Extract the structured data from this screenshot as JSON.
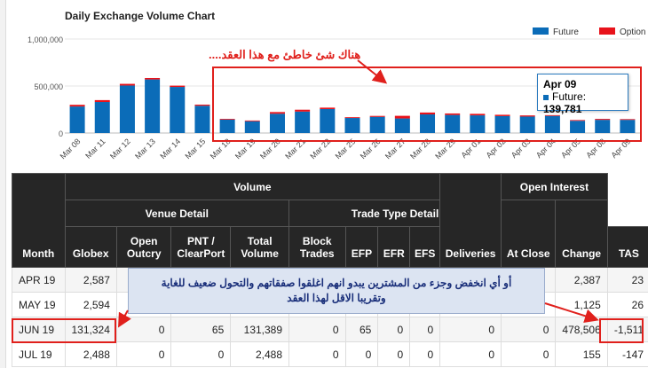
{
  "chart_data": {
    "type": "bar",
    "title": "Daily Exchange Volume Chart",
    "categories": [
      "Mar 08",
      "Mar 11",
      "Mar 12",
      "Mar 13",
      "Mar 14",
      "Mar 15",
      "Mar 18",
      "Mar 19",
      "Mar 20",
      "Mar 21",
      "Mar 22",
      "Mar 25",
      "Mar 26",
      "Mar 27",
      "Mar 28",
      "Mar 29",
      "Apr 01",
      "Apr 02",
      "Apr 03",
      "Apr 04",
      "Apr 05",
      "Apr 08",
      "Apr 09"
    ],
    "series": [
      {
        "name": "Future",
        "color": "#0b6cb8",
        "values": [
          282000,
          330000,
          505000,
          570000,
          490000,
          290000,
          143000,
          125000,
          205000,
          228000,
          255000,
          160000,
          172000,
          155000,
          198000,
          192000,
          188000,
          180000,
          175000,
          182000,
          130000,
          140000,
          139781
        ]
      },
      {
        "name": "Option",
        "color": "#e8131b",
        "values": [
          18000,
          20000,
          18000,
          15000,
          14000,
          12000,
          8000,
          8000,
          18000,
          20000,
          15000,
          8000,
          10000,
          28000,
          20000,
          16000,
          16000,
          14000,
          12000,
          8000,
          8000,
          10000,
          8000
        ]
      }
    ],
    "ylim": [
      0,
      1000000
    ],
    "yticks": [
      "0",
      "500,000",
      "1,000,000"
    ],
    "legend_position": "top-right",
    "tooltip": {
      "date": "Apr 09",
      "series": "Future",
      "value": "139,781"
    }
  },
  "annotations": {
    "chart_note": "هناك شئ خاطئ مع هذا العقد....",
    "table_note_line1": "أو أي انخفض وجزء من المشترين يبدو انهم اغلقوا صفقاتهم والتحول ضعيف للغاية",
    "table_note_line2": "وتقريبا الاقل لهذا العقد"
  },
  "table": {
    "group_volume": "Volume",
    "group_venue": "Venue Detail",
    "group_trade": "Trade Type Detail",
    "group_oi": "Open Interest",
    "headers": {
      "month": "Month",
      "globex": "Globex",
      "open_outcry_1": "Open",
      "open_outcry_2": "Outcry",
      "pnt_1": "PNT /",
      "pnt_2": "ClearPort",
      "total_1": "Total",
      "total_2": "Volume",
      "block_1": "Block",
      "block_2": "Trades",
      "efp": "EFP",
      "efr": "EFR",
      "efs": "EFS",
      "tas": "TAS",
      "deliveries": "Deliveries",
      "at_close": "At Close",
      "change": "Change"
    },
    "rows": [
      {
        "month": "APR 19",
        "globex": "2,587",
        "open_outcry": "",
        "pnt": "",
        "total": "",
        "block": "",
        "efp": "",
        "efr": "",
        "efs": "",
        "tas": "",
        "deliveries": "",
        "at_close": "2,387",
        "change": "23"
      },
      {
        "month": "MAY 19",
        "globex": "2,594",
        "open_outcry": "",
        "pnt": "",
        "total": "",
        "block": "",
        "efp": "",
        "efr": "",
        "efs": "",
        "tas": "",
        "deliveries": "",
        "at_close": "1,125",
        "change": "26"
      },
      {
        "month": "JUN 19",
        "globex": "131,324",
        "open_outcry": "0",
        "pnt": "65",
        "total": "131,389",
        "block": "0",
        "efp": "65",
        "efr": "0",
        "efs": "0",
        "tas": "0",
        "deliveries": "0",
        "at_close": "478,506",
        "change": "-1,511"
      },
      {
        "month": "JUL 19",
        "globex": "2,488",
        "open_outcry": "0",
        "pnt": "0",
        "total": "2,488",
        "block": "0",
        "efp": "0",
        "efr": "0",
        "efs": "0",
        "tas": "0",
        "deliveries": "0",
        "at_close": "155",
        "change": "-147"
      }
    ]
  }
}
